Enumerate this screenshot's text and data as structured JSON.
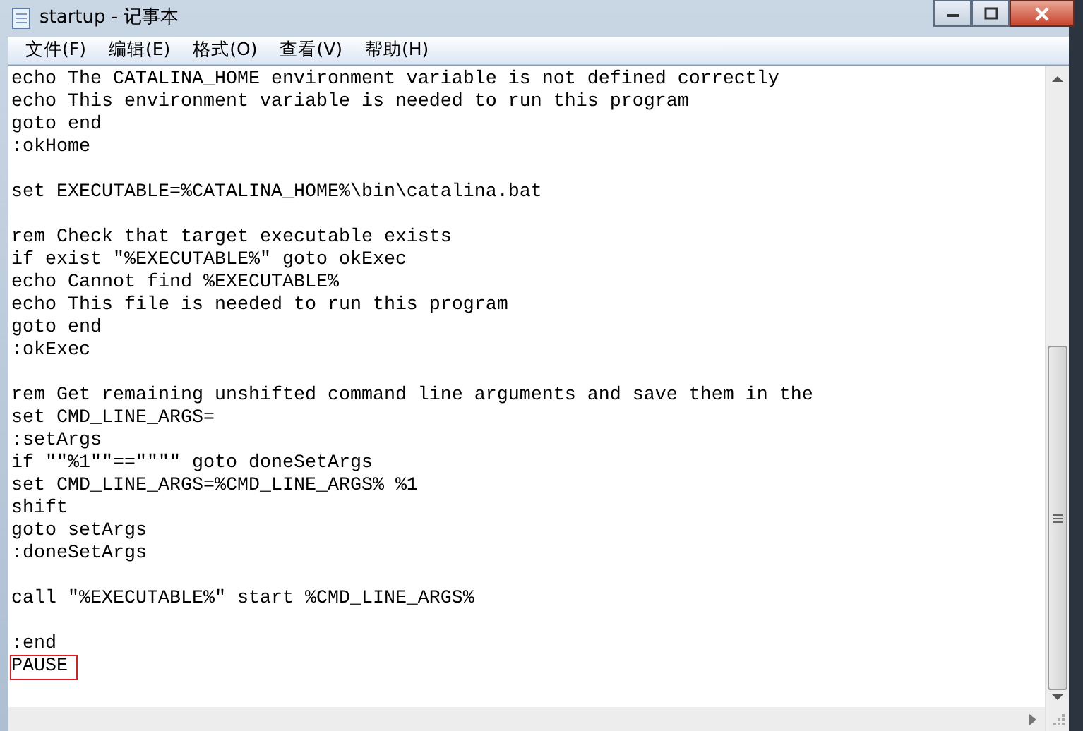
{
  "window": {
    "title": "startup - 记事本"
  },
  "menu": [
    "文件(F)",
    "编辑(E)",
    "格式(O)",
    "查看(V)",
    "帮助(H)"
  ],
  "lines": [
    {
      "kind": "text",
      "text": "echo The CATALINA_HOME environment variable is not defined correctly"
    },
    {
      "kind": "text",
      "text": "echo This environment variable is needed to run this program"
    },
    {
      "kind": "text",
      "text": "goto end"
    },
    {
      "kind": "text",
      "text": ":okHome"
    },
    {
      "kind": "blank"
    },
    {
      "kind": "text",
      "text": "set EXECUTABLE=%CATALINA_HOME%\\bin\\catalina.bat"
    },
    {
      "kind": "blank"
    },
    {
      "kind": "text",
      "text": "rem Check that target executable exists"
    },
    {
      "kind": "text",
      "text": "if exist \"%EXECUTABLE%\" goto okExec"
    },
    {
      "kind": "text",
      "text": "echo Cannot find %EXECUTABLE%"
    },
    {
      "kind": "text",
      "text": "echo This file is needed to run this program"
    },
    {
      "kind": "text",
      "text": "goto end"
    },
    {
      "kind": "text",
      "text": ":okExec"
    },
    {
      "kind": "blank"
    },
    {
      "kind": "text",
      "text": "rem Get remaining unshifted command line arguments and save them in the"
    },
    {
      "kind": "text",
      "text": "set CMD_LINE_ARGS="
    },
    {
      "kind": "text",
      "text": ":setArgs"
    },
    {
      "kind": "text",
      "text": "if \"\"%1\"\"==\"\"\"\" goto doneSetArgs"
    },
    {
      "kind": "text",
      "text": "set CMD_LINE_ARGS=%CMD_LINE_ARGS% %1"
    },
    {
      "kind": "text",
      "text": "shift"
    },
    {
      "kind": "text",
      "text": "goto setArgs"
    },
    {
      "kind": "text",
      "text": ":doneSetArgs"
    },
    {
      "kind": "blank"
    },
    {
      "kind": "text",
      "text": "call \"%EXECUTABLE%\" start %CMD_LINE_ARGS%"
    },
    {
      "kind": "blank"
    },
    {
      "kind": "text",
      "text": ":end"
    },
    {
      "kind": "marked",
      "text": "PAUSE"
    }
  ]
}
